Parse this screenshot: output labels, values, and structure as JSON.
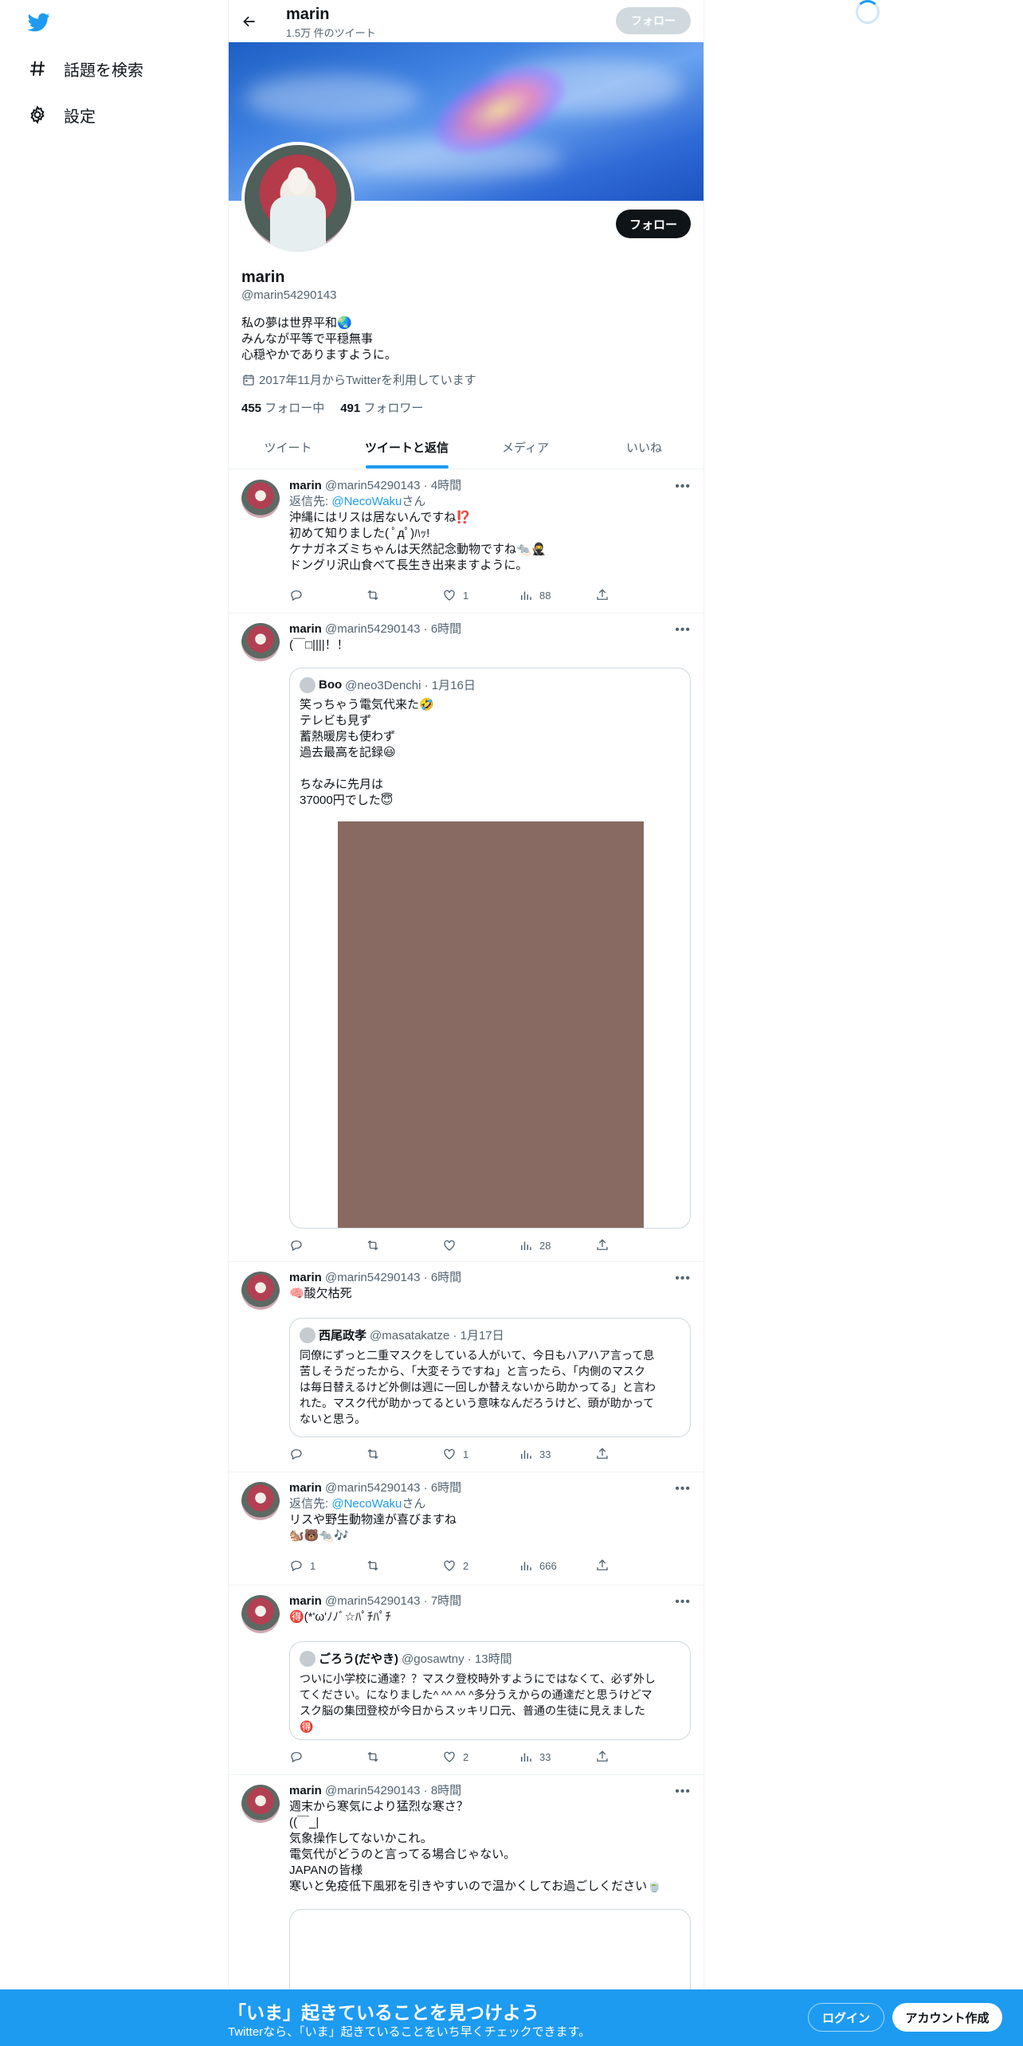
{
  "sidebar": {
    "items": [
      {
        "label": "話題を検索",
        "icon": "hashtag-icon"
      },
      {
        "label": "設定",
        "icon": "gear-icon"
      }
    ]
  },
  "header": {
    "title": "marin",
    "subtitle": "1.5万 件のツイート",
    "follow_label": "フォロー"
  },
  "profile": {
    "name": "marin",
    "handle": "@marin54290143",
    "bio": [
      "私の夢は世界平和🌏",
      "みんなが平等で平穏無事",
      "心穏やかでありますように。"
    ],
    "joined": "2017年11月からTwitterを利用しています",
    "following_count": "455",
    "following_label": "フォロー中",
    "followers_count": "491",
    "followers_label": "フォロワー",
    "follow_label": "フォロー"
  },
  "tabs": [
    {
      "label": "ツイート"
    },
    {
      "label": "ツイートと返信"
    },
    {
      "label": "メディア"
    },
    {
      "label": "いいね"
    }
  ],
  "tweets": [
    {
      "name": "marin",
      "meta": "@marin54290143 · 4時間",
      "reply_prefix": "返信先: ",
      "reply_mention": "@NecoWaku",
      "reply_suffix": "さん",
      "lines": [
        "沖縄にはリスは居ないんですね⁉️",
        "初めて知りました( ﾟдﾟ)ﾊｯ!",
        "ケナガネズミちゃんは天然記念動物ですね🐀🥷",
        "ドングリ沢山食べて長生き出来ますように。"
      ],
      "likes": "1",
      "views": "88"
    },
    {
      "name": "marin",
      "meta": "@marin54290143 · 6時間",
      "lines": [
        "(￣□||||！！"
      ],
      "quote": {
        "name": "Boo",
        "meta": "@neo3Denchi · 1月16日",
        "lines": [
          "笑っちゃう電気代来た🤣",
          "テレビも見ず",
          "蓄熱暖房も使わず",
          "過去最高を記録😃",
          "",
          "ちなみに先月は",
          "37000円でした😇"
        ]
      },
      "views": "28"
    },
    {
      "name": "marin",
      "meta": "@marin54290143 · 6時間",
      "lines": [
        "🧠酸欠枯死"
      ],
      "quote": {
        "name": "西尾政孝",
        "meta": "@masatakatze · 1月17日",
        "lines": [
          "同僚にずっと二重マスクをしている人がいて、今日もハアハア言って息",
          "苦しそうだったから、「大変そうですね」と言ったら、「内側のマスク",
          "は毎日替えるけど外側は週に一回しか替えないから助かってる」と言わ",
          "れた。マスク代が助かってるという意味なんだろうけど、頭が助かって",
          "ないと思う。"
        ]
      },
      "likes": "1",
      "views": "33"
    },
    {
      "name": "marin",
      "meta": "@marin54290143 · 6時間",
      "reply_prefix": "返信先: ",
      "reply_mention": "@NecoWaku",
      "reply_suffix": "さん",
      "lines": [
        "リスや野生動物達が喜びますね",
        "🐿️🐻🐀🎶"
      ],
      "replies": "1",
      "likes": "2",
      "views": "666"
    },
    {
      "name": "marin",
      "meta": "@marin54290143 · 7時間",
      "lines": [
        "🉐(*'ω'ﾉﾉﾞ☆ﾊﾟﾁﾊﾟﾁ"
      ],
      "quote": {
        "name": "ごろう(だやき)",
        "meta": "@gosawtny · 13時間",
        "lines": [
          "ついに小学校に通達？？マスク登校時外すようにではなくて、必ず外し",
          "てください。になりました^ ^^ ^^ ^多分うえからの通達だと思うけどマ",
          "スク脳の集団登校が今日からスッキリ口元、普通の生徒に見えました",
          "🉐"
        ]
      },
      "likes": "2",
      "views": "33"
    },
    {
      "name": "marin",
      "meta": "@marin54290143 · 8時間",
      "lines": [
        "週末から寒気により猛烈な寒さ？",
        "((￣_|",
        "気象操作してないかこれ。",
        "電気代がどうのと言ってる場合じゃない。",
        "JAPANの皆様",
        "寒いと免疫低下風邪を引きやすいので温かくしてお過ごしください🍵"
      ]
    }
  ],
  "bottom_bar": {
    "title": "「いま」起きていることを見つけよう",
    "subtitle": "Twitterなら、「いま」起きていることをいち早くチェックできます。",
    "login_label": "ログイン",
    "signup_label": "アカウント作成"
  }
}
